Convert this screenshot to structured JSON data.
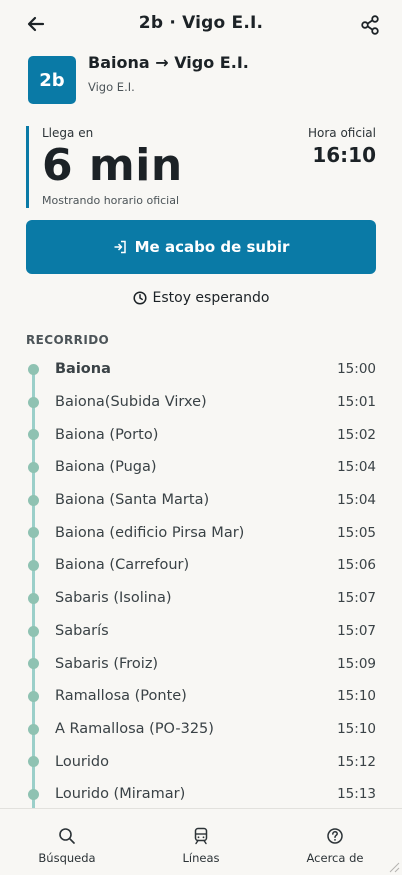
{
  "header": {
    "title": "2b · Vigo E.I.",
    "back_icon": "arrow-left-icon",
    "share_icon": "share-icon"
  },
  "route": {
    "badge": "2b",
    "name": "Baiona → Vigo E.I.",
    "operator": "Vigo E.I."
  },
  "arrival": {
    "label": "Llega en",
    "value": "6 min",
    "note": "Mostrando horario oficial",
    "official_label": "Hora oficial",
    "official_time": "16:10"
  },
  "actions": {
    "board_label": "Me acabo de subir",
    "wait_label": "Estoy esperando"
  },
  "section": {
    "title": "RECORRIDO"
  },
  "stops": [
    {
      "name": "Baiona",
      "time": "15:00"
    },
    {
      "name": "Baiona(Subida Virxe)",
      "time": "15:01"
    },
    {
      "name": "Baiona (Porto)",
      "time": "15:02"
    },
    {
      "name": "Baiona (Puga)",
      "time": "15:04"
    },
    {
      "name": "Baiona (Santa Marta)",
      "time": "15:04"
    },
    {
      "name": "Baiona (edificio Pirsa Mar)",
      "time": "15:05"
    },
    {
      "name": "Baiona (Carrefour)",
      "time": "15:06"
    },
    {
      "name": "Sabaris (Isolina)",
      "time": "15:07"
    },
    {
      "name": "Sabarís",
      "time": "15:07"
    },
    {
      "name": "Sabaris (Froiz)",
      "time": "15:09"
    },
    {
      "name": "Ramallosa (Ponte)",
      "time": "15:10"
    },
    {
      "name": "A Ramallosa (PO-325)",
      "time": "15:10"
    },
    {
      "name": "Lourido",
      "time": "15:12"
    },
    {
      "name": "Lourido (Miramar)",
      "time": "15:13"
    }
  ],
  "nav": {
    "search_label": "Búsqueda",
    "lines_label": "Líneas",
    "about_label": "Acerca de"
  },
  "colors": {
    "accent": "#0a7aa6",
    "rail": "#9bcfc9",
    "dot": "#8fc2b2",
    "background": "#f8f7f4"
  }
}
